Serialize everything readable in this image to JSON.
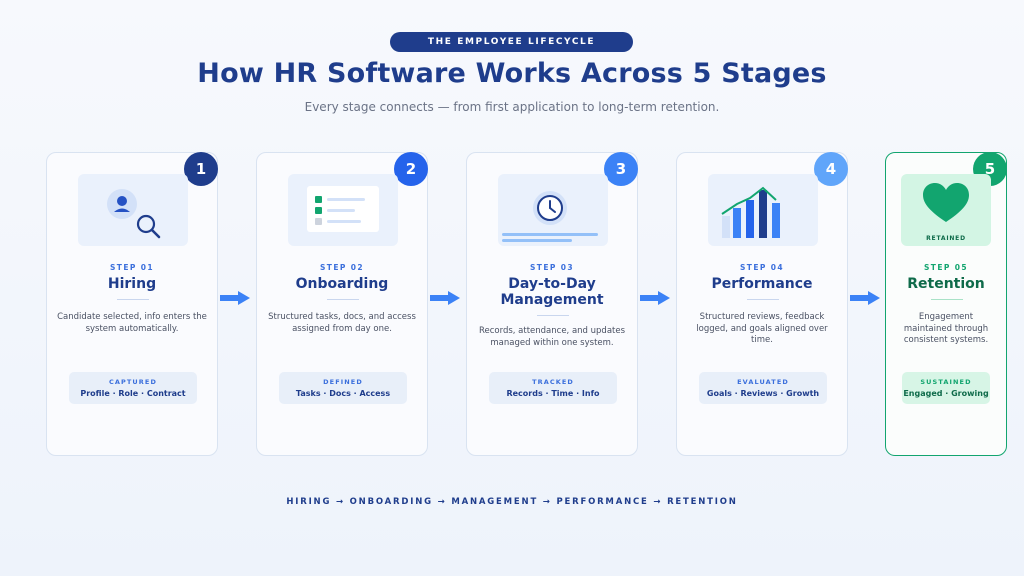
{
  "header": {
    "pill": "THE EMPLOYEE LIFECYCLE",
    "title": "How HR Software Works Across 5 Stages",
    "subtitle": "Every stage connects — from first application to long-term retention."
  },
  "stages": [
    {
      "number": "1",
      "step": "STEP 01",
      "title": "Hiring",
      "description": "Candidate selected, info enters the system automatically.",
      "tag_head": "CAPTURED",
      "tag_items": "Profile · Role · Contract",
      "badge_color": "#1f3d8c",
      "icon": "candidate-search-icon"
    },
    {
      "number": "2",
      "step": "STEP 02",
      "title": "Onboarding",
      "description": "Structured tasks, docs, and access assigned from day one.",
      "tag_head": "DEFINED",
      "tag_items": "Tasks · Docs · Access",
      "badge_color": "#2563eb",
      "icon": "checklist-icon"
    },
    {
      "number": "3",
      "step": "STEP 03",
      "title": "Day-to-Day Management",
      "description": "Records, attendance, and updates managed within one system.",
      "tag_head": "TRACKED",
      "tag_items": "Records · Time · Info",
      "badge_color": "#3b82f6",
      "icon": "clock-icon"
    },
    {
      "number": "4",
      "step": "STEP 04",
      "title": "Performance",
      "description": "Structured reviews, feedback logged, and goals aligned over time.",
      "tag_head": "EVALUATED",
      "tag_items": "Goals · Reviews · Growth",
      "badge_color": "#60a5fa",
      "icon": "bar-chart-icon"
    },
    {
      "number": "5",
      "step": "STEP 05",
      "title": "Retention",
      "description": "Engagement maintained through consistent systems.",
      "tag_head": "SUSTAINED",
      "tag_items": "Engaged · Growing",
      "badge_color": "#12a56f",
      "icon": "heart-icon",
      "illustration_label": "RETAINED"
    }
  ],
  "footer": "HIRING → ONBOARDING → MANAGEMENT → PERFORMANCE → RETENTION",
  "colors": {
    "primary": "#1f3d8c",
    "accent": "#3b6fdc",
    "arrow": "#3b82f6",
    "success": "#12a56f"
  }
}
